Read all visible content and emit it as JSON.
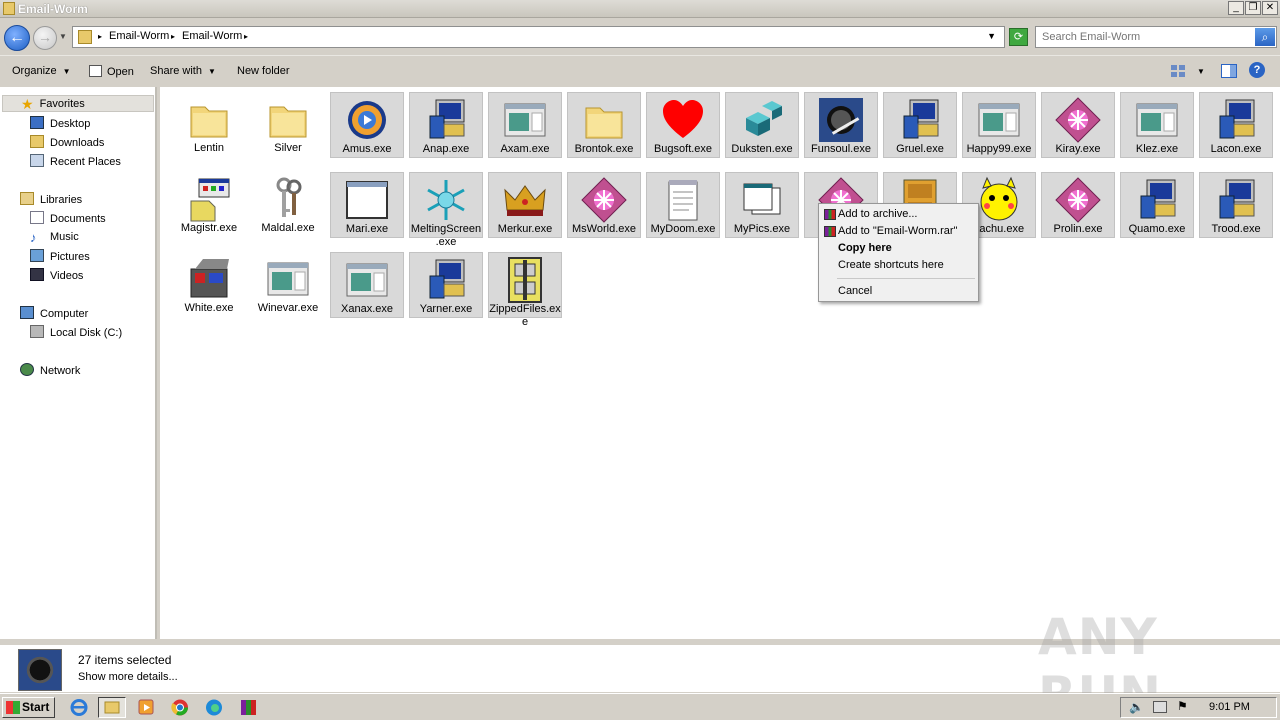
{
  "window": {
    "title": "Email-Worm"
  },
  "address": {
    "crumbs": [
      "Email-Worm",
      "Email-Worm"
    ],
    "search_placeholder": "Search Email-Worm"
  },
  "toolbar": {
    "organize": "Organize",
    "open": "Open",
    "share_with": "Share with",
    "new_folder": "New folder"
  },
  "nav": {
    "favorites": "Favorites",
    "desktop": "Desktop",
    "downloads": "Downloads",
    "recent": "Recent Places",
    "libraries": "Libraries",
    "documents": "Documents",
    "music": "Music",
    "pictures": "Pictures",
    "videos": "Videos",
    "computer": "Computer",
    "localdisk": "Local Disk (C:)",
    "network": "Network"
  },
  "files": [
    {
      "name": "Lentin",
      "icon": "folder-icon",
      "selected": false
    },
    {
      "name": "Silver",
      "icon": "folder-icon",
      "selected": false
    },
    {
      "name": "Amus.exe",
      "icon": "media-player-icon",
      "selected": true
    },
    {
      "name": "Anap.exe",
      "icon": "computer-installer-icon",
      "selected": true
    },
    {
      "name": "Axam.exe",
      "icon": "window-app-icon",
      "selected": true
    },
    {
      "name": "Brontok.exe",
      "icon": "folder-icon",
      "selected": true
    },
    {
      "name": "Bugsoft.exe",
      "icon": "heart-icon",
      "selected": true
    },
    {
      "name": "Duksten.exe",
      "icon": "cubes-icon",
      "selected": true
    },
    {
      "name": "Funsoul.exe",
      "icon": "photo-icon",
      "selected": true
    },
    {
      "name": "Gruel.exe",
      "icon": "computer-installer-icon",
      "selected": true
    },
    {
      "name": "Happy99.exe",
      "icon": "window-app-icon",
      "selected": true
    },
    {
      "name": "Kiray.exe",
      "icon": "pink-diamond-icon",
      "selected": true
    },
    {
      "name": "Klez.exe",
      "icon": "window-app-icon",
      "selected": true
    },
    {
      "name": "Lacon.exe",
      "icon": "computer-installer-icon",
      "selected": true
    },
    {
      "name": "Magistr.exe",
      "icon": "setup-box-icon",
      "selected": false
    },
    {
      "name": "Maldal.exe",
      "icon": "keys-icon",
      "selected": false
    },
    {
      "name": "Mari.exe",
      "icon": "blank-window-icon",
      "selected": true
    },
    {
      "name": "MeltingScreen.exe",
      "icon": "snowflake-icon",
      "selected": true
    },
    {
      "name": "Merkur.exe",
      "icon": "crown-icon",
      "selected": true
    },
    {
      "name": "MsWorld.exe",
      "icon": "pink-diamond-icon",
      "selected": true
    },
    {
      "name": "MyDoom.exe",
      "icon": "notepad-icon",
      "selected": true
    },
    {
      "name": "MyPics.exe",
      "icon": "window-stack-icon",
      "selected": true
    },
    {
      "name": "N",
      "icon": "pink-diamond-icon",
      "selected": true
    },
    {
      "name": "",
      "icon": "archive-cabinet-icon",
      "selected": true
    },
    {
      "name": "kachu.exe",
      "icon": "pikachu-icon",
      "selected": true
    },
    {
      "name": "Prolin.exe",
      "icon": "pink-diamond-icon",
      "selected": true
    },
    {
      "name": "Quamo.exe",
      "icon": "computer-installer-icon",
      "selected": true
    },
    {
      "name": "Trood.exe",
      "icon": "computer-installer-icon",
      "selected": true
    },
    {
      "name": "White.exe",
      "icon": "media-box-icon",
      "selected": false
    },
    {
      "name": "Winevar.exe",
      "icon": "window-app-icon",
      "selected": false
    },
    {
      "name": "Xanax.exe",
      "icon": "window-app-icon",
      "selected": true
    },
    {
      "name": "Yarner.exe",
      "icon": "computer-installer-icon",
      "selected": true
    },
    {
      "name": "ZippedFiles.exe",
      "icon": "zip-cabinet-icon",
      "selected": true
    }
  ],
  "context_menu": {
    "add_archive": "Add to archive...",
    "add_rar": "Add to \"Email-Worm.rar\"",
    "copy_here": "Copy here",
    "create_shortcuts": "Create shortcuts here",
    "cancel": "Cancel"
  },
  "details": {
    "count": "27 items selected",
    "more": "Show more details..."
  },
  "watermark": "ANY RUN",
  "taskbar": {
    "start": "Start",
    "clock": "9:01 PM"
  }
}
